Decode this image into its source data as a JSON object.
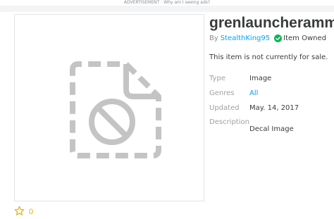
{
  "ad": {
    "label": "ADVERTISEMENT",
    "separator": "-",
    "link": "Why am I seeing ads?"
  },
  "thumbnail": {
    "icon": "unavailable-image-icon"
  },
  "favorites": {
    "icon": "star-icon",
    "count": "0"
  },
  "item": {
    "title": "grenlauncherammo",
    "by_label": "By",
    "creator": "StealthKing95",
    "owned_icon": "check-circle-icon",
    "owned_label": "Item Owned",
    "sale_note": "This item is not currently for sale."
  },
  "details": {
    "type_label": "Type",
    "type_value": "Image",
    "genres_label": "Genres",
    "genres_value": "All",
    "updated_label": "Updated",
    "updated_value": "May. 14, 2017",
    "description_label": "Description",
    "description_value": "Decal Image"
  },
  "colors": {
    "link": "#00a2ff",
    "owned": "#02b757",
    "star": "#e8b10d",
    "placeholder": "#c4c4c4"
  }
}
